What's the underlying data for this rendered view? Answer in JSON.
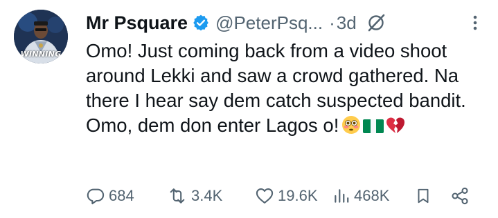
{
  "author": {
    "name": "Mr Psquare",
    "handle": "@PeterPsq...",
    "separator": "·",
    "time": "3d",
    "avatar_caption": "WINNING"
  },
  "body_text": "Omo! Just coming back from a video shoot around Lekki and saw a crowd gathered. Na there I hear say dem catch suspected bandit. Omo, dem don enter Lagos o!",
  "emojis": [
    "flushed-face",
    "nigeria-flag",
    "broken-heart"
  ],
  "actions": {
    "replies": "684",
    "reposts": "3.4K",
    "likes": "19.6K",
    "views": "468K"
  },
  "colors": {
    "text": "#0f1419",
    "secondary": "#536471",
    "verified": "#1d9bf0"
  }
}
